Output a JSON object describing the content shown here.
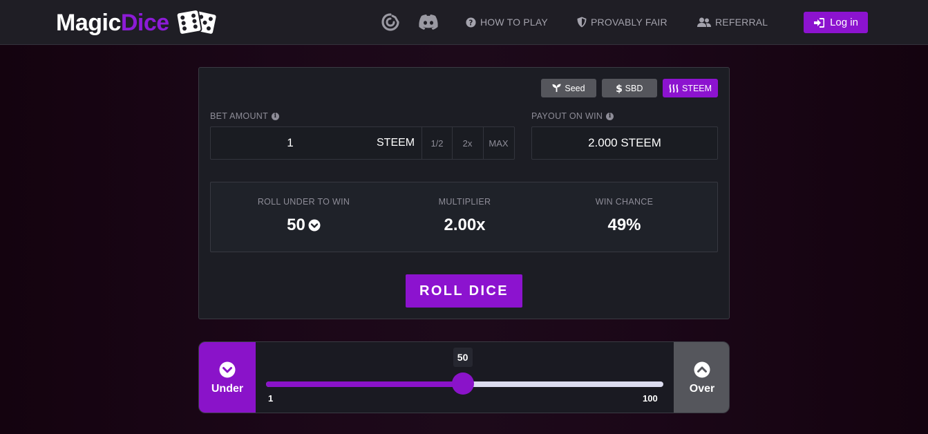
{
  "header": {
    "logo": {
      "part1": "Magic",
      "part2": "Dice"
    },
    "nav": {
      "how_to_play": "HOW TO PLAY",
      "provably_fair": "PROVABLY FAIR",
      "referral": "REFERRAL"
    },
    "login_label": "Log in"
  },
  "card": {
    "currency_buttons": [
      {
        "label": "Seed",
        "icon": "seedling-icon",
        "active": false
      },
      {
        "label": "SBD",
        "icon": "dollar-icon",
        "active": false
      },
      {
        "label": "STEEM",
        "icon": "steem-icon",
        "active": true
      }
    ],
    "bet": {
      "label": "BET AMOUNT",
      "value": "1",
      "unit": "STEEM",
      "options": [
        "1/2",
        "2x",
        "MAX"
      ]
    },
    "payout": {
      "label": "PAYOUT ON WIN",
      "value": "2.000 STEEM"
    },
    "stats": {
      "roll_under": {
        "label": "ROLL UNDER TO WIN",
        "value": "50"
      },
      "multiplier": {
        "label": "MULTIPLIER",
        "value": "2.00x"
      },
      "win_chance": {
        "label": "WIN CHANCE",
        "value": "49%"
      }
    },
    "roll_label": "ROLL DICE"
  },
  "slider": {
    "under_label": "Under",
    "over_label": "Over",
    "min": 1,
    "max": 100,
    "value": 50,
    "min_label": "1",
    "max_label": "100",
    "value_label": "50"
  },
  "colors": {
    "accent": "#8c13cf",
    "header_bg": "#1f1e25",
    "card_bg": "#1c1d24",
    "muted_text": "#8e8d98"
  }
}
